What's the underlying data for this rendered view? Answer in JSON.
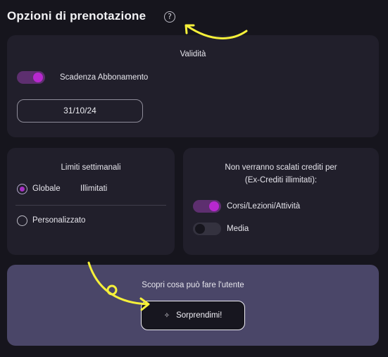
{
  "page": {
    "title": "Opzioni di prenotazione",
    "help_icon": "?"
  },
  "validity": {
    "heading": "Validità",
    "toggle_label": "Scadenza Abbonamento",
    "toggle_on": true,
    "date_value": "31/10/24"
  },
  "limits": {
    "heading": "Limiti settimanali",
    "options": [
      {
        "label": "Globale",
        "selected": true,
        "value": "Illimitati"
      },
      {
        "label": "Personalizzato",
        "selected": false
      }
    ]
  },
  "credits": {
    "heading_line1": "Non verranno scalati crediti per",
    "heading_line2": "(Ex-Crediti illimitati):",
    "toggles": [
      {
        "label": "Corsi/Lezioni/Attività",
        "on": true
      },
      {
        "label": "Media",
        "on": false
      }
    ]
  },
  "discover": {
    "text": "Scopri cosa può fare l'utente",
    "button_label": "Sorprendimi!",
    "button_icon": "sparkle-icon"
  },
  "colors": {
    "background": "#16151d",
    "card": "#211f2b",
    "highlight_card": "#4a4668",
    "accent": "#b728cf",
    "annotation": "#f5f03a"
  }
}
